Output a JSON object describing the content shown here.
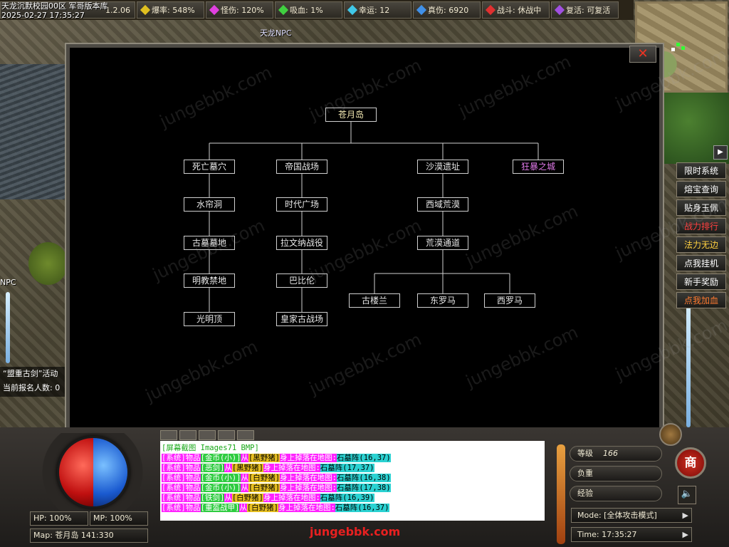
{
  "window": {
    "title_overlay_line1": "天龙沉默校园00区 军哥版本库",
    "title_overlay_line2": "2025-02-27 17:35:27"
  },
  "topbar": {
    "stats": [
      {
        "label": "1.2.06",
        "color": "#d8d8d8"
      },
      {
        "label": "爆率: 548%",
        "color": "#e0c020"
      },
      {
        "label": "怪伤: 120%",
        "color": "#e040e0"
      },
      {
        "label": "吸血: 1%",
        "color": "#40d040"
      },
      {
        "label": "幸运: 12",
        "color": "#40c8e8"
      },
      {
        "label": "真伤: 6920",
        "color": "#4090e8"
      },
      {
        "label": "战斗: 休战中",
        "color": "#e03030"
      },
      {
        "label": "复活: 可复活",
        "color": "#a050e0"
      }
    ]
  },
  "scene": {
    "npc_label": "天龙NPC",
    "left_npc_label": "NPC",
    "left_event_line1": "“盟重古剑”活动",
    "left_event_line2": "当前报名人数: 0"
  },
  "sidemenu": {
    "arrow": "▶",
    "items": [
      {
        "label": "限时系统",
        "color": "#ffffff"
      },
      {
        "label": "熔宝查询",
        "color": "#ffffff"
      },
      {
        "label": "贴身玉佩",
        "color": "#ffffff"
      },
      {
        "label": "战力排行",
        "color": "#ff4040"
      },
      {
        "label": "法力无边",
        "color": "#ffd040"
      },
      {
        "label": "点我挂机",
        "color": "#ffffff"
      },
      {
        "label": "新手奖励",
        "color": "#ffffff"
      },
      {
        "label": "点我加血",
        "color": "#ff7a30"
      }
    ]
  },
  "map_dialog": {
    "close_icon": "close-icon",
    "root": "苍月岛",
    "branches": [
      {
        "label": "死亡墓穴",
        "children": [
          "水帘洞",
          "古墓墓地",
          "明教禁地",
          "光明顶"
        ]
      },
      {
        "label": "帝国战场",
        "children": [
          "时代广场",
          "拉文纳战役",
          "巴比伦",
          "皇家古战场"
        ]
      },
      {
        "label": "沙漠遗址",
        "children": [
          "西域荒漠",
          "荒漠通道"
        ],
        "leaves": [
          "古楼兰",
          "东罗马",
          "西罗马"
        ]
      },
      {
        "label": "狂暴之城",
        "special": true,
        "children": []
      }
    ],
    "watermark": "jungebbk.com"
  },
  "hud": {
    "hp": "HP: 100%",
    "mp": "MP: 100%",
    "map": "Map: 苍月岛 141:330",
    "site": "jungebbk.com",
    "level_label": "等级",
    "level_value": "166",
    "weight_label": "负重",
    "exp_label": "经验",
    "mode": "Mode: [全体攻击模式]",
    "time": "Time: 17:35:27",
    "shop_label": "商",
    "sound_icon": "🔈"
  },
  "chat": {
    "screenshot_line": "[屏幕截图  Images71 BMP]",
    "lines": [
      {
        "item": "金币(小)",
        "mob": "黑野猪",
        "pos": "16,37"
      },
      {
        "item": "恶剑",
        "mob": "黑野猪",
        "pos": "17,37"
      },
      {
        "item": "金币(小)",
        "mob": "白野猪",
        "pos": "16,38"
      },
      {
        "item": "金币(小)",
        "mob": "白野猪",
        "pos": "17,38"
      },
      {
        "item": "铁剑",
        "mob": "白野猪",
        "pos": "16,39"
      },
      {
        "item": "重盔战甲",
        "mob": "白野猪",
        "pos": "16,37"
      }
    ],
    "prefix": "[系统]物品",
    "from": "从",
    "mid": "身上掉落在地图:",
    "map": "石墓阵"
  }
}
